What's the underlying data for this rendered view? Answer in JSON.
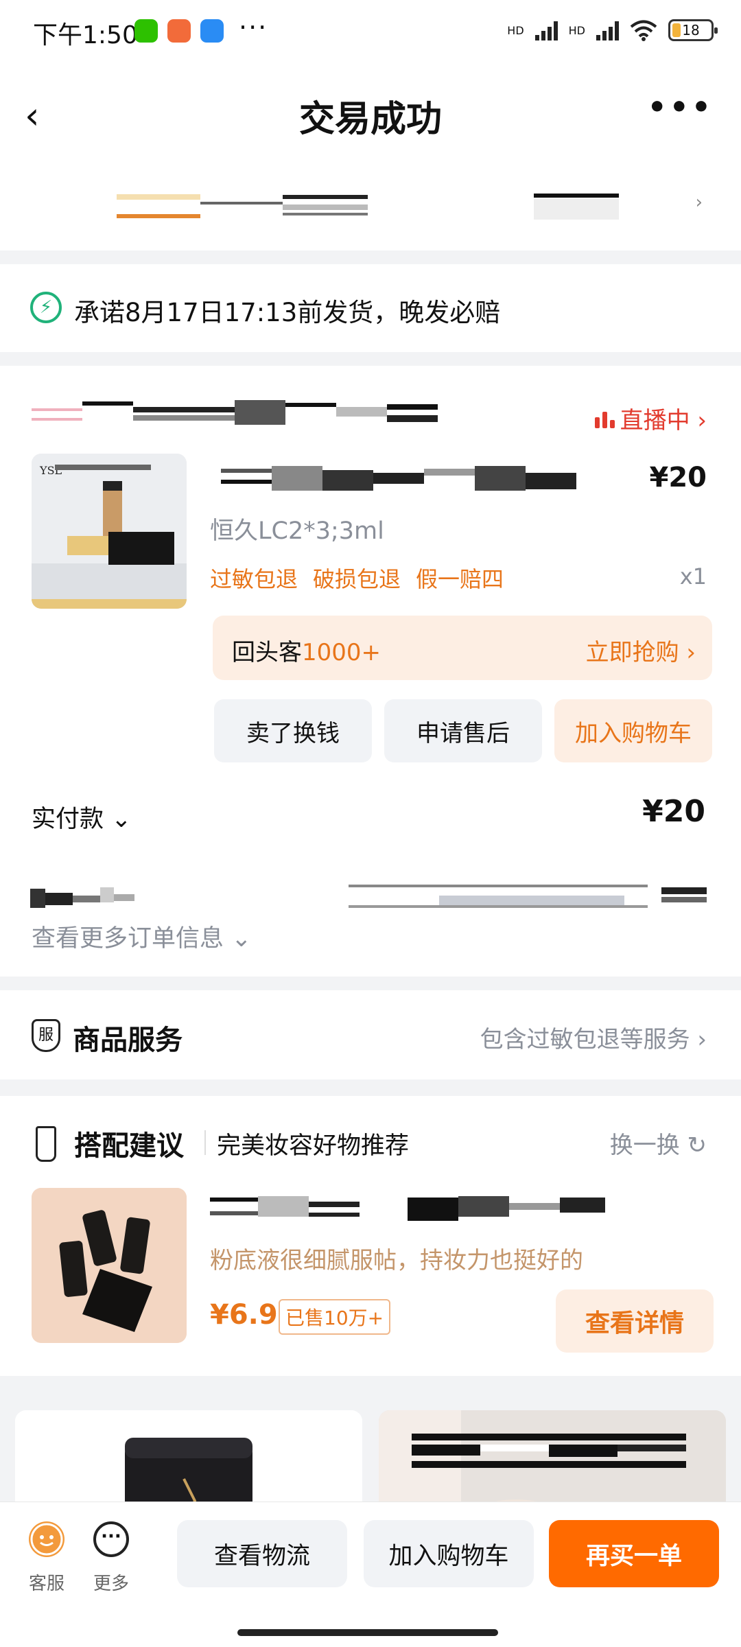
{
  "status_bar": {
    "time": "下午1:50",
    "dots": "···",
    "net1": "HD",
    "net2": "HD",
    "battery": "18"
  },
  "nav": {
    "back": "‹",
    "title": "交易成功",
    "more": "•••"
  },
  "promise": {
    "icon": "⚡",
    "text": "承诺8月17日17:13前发货，晚发必赔"
  },
  "order": {
    "live_label": "直播中 ›",
    "price": "¥20",
    "variant": "恒久LC2*3;3ml",
    "tags": [
      "过敏包退",
      "破损包退",
      "假一赔四"
    ],
    "quantity": "x1",
    "returning_prefix": "回头客",
    "returning_count": "1000+",
    "returning_action": "立即抢购 ›",
    "buttons": {
      "sell": "卖了换钱",
      "after_sale": "申请售后",
      "add_cart": "加入购物车"
    },
    "paid_label": "实付款 ⌄",
    "paid_amount": "¥20",
    "more_info": "查看更多订单信息 ⌄"
  },
  "service": {
    "icon": "服",
    "title": "商品服务",
    "subtitle": "包含过敏包退等服务 ›"
  },
  "suggestion": {
    "title": "搭配建议",
    "subtitle": "完美妆容好物推荐",
    "refresh": "换一换 ↻",
    "description": "粉底液很细腻服帖，持妆力也挺好的",
    "price": "¥6.9",
    "sold": "已售10万+",
    "detail_button": "查看详情"
  },
  "bottom_bar": {
    "service_label": "客服",
    "more_label": "更多",
    "logistics": "查看物流",
    "add_cart": "加入购物车",
    "buy_again": "再买一单"
  },
  "colors": {
    "accent_orange": "#e8751a",
    "buy_button": "#ff6a00",
    "live_red": "#e23b2e",
    "promise_green": "#20b27a"
  }
}
